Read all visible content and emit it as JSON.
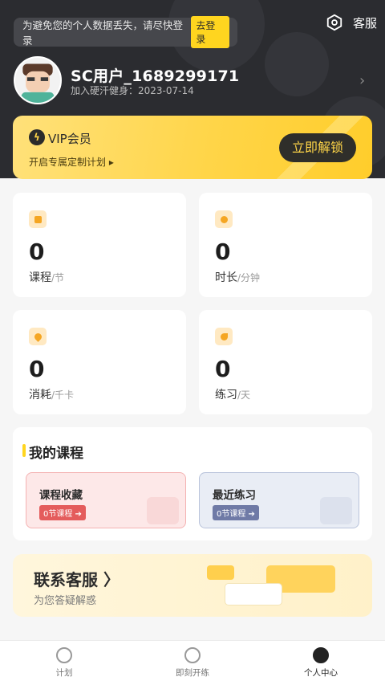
{
  "header": {
    "banner_text": "为避免您的个人数据丢失，请尽快登录",
    "login_button": "去登录",
    "service_label": "客服",
    "icons": {
      "settings": "settings-hex-icon",
      "chevron": "chevron-right-icon"
    }
  },
  "profile": {
    "username": "SC用户_1689299171",
    "joined": "加入硬汗健身：2023-07-14"
  },
  "vip": {
    "title": "VIP会员",
    "subtitle": "开启专属定制计划 ▸",
    "button": "立即解锁"
  },
  "stats": [
    {
      "value": "0",
      "label": "课程",
      "unit": "/节",
      "icon": "course-box-icon"
    },
    {
      "value": "0",
      "label": "时长",
      "unit": "/分钟",
      "icon": "stopwatch-icon"
    },
    {
      "value": "0",
      "label": "消耗",
      "unit": "/千卡",
      "icon": "flame-icon"
    },
    {
      "value": "0",
      "label": "练习",
      "unit": "/天",
      "icon": "muscle-arm-icon"
    }
  ],
  "my_courses": {
    "title": "我的课程",
    "favorites": {
      "title": "课程收藏",
      "badge": "0节课程 ➔"
    },
    "recent": {
      "title": "最近练习",
      "badge": "0节课程 ➔"
    }
  },
  "contact": {
    "title": "联系客服 〉",
    "subtitle": "为您答疑解惑"
  },
  "tabs": [
    {
      "label": "计划",
      "icon": "pulse-icon"
    },
    {
      "label": "即刻开练",
      "icon": "stopwatch-icon"
    },
    {
      "label": "个人中心",
      "icon": "person-icon"
    }
  ],
  "colors": {
    "accent": "#ffd51f",
    "dark": "#2b2c30",
    "red": "#e45c5c",
    "slate": "#6f7aa6"
  }
}
